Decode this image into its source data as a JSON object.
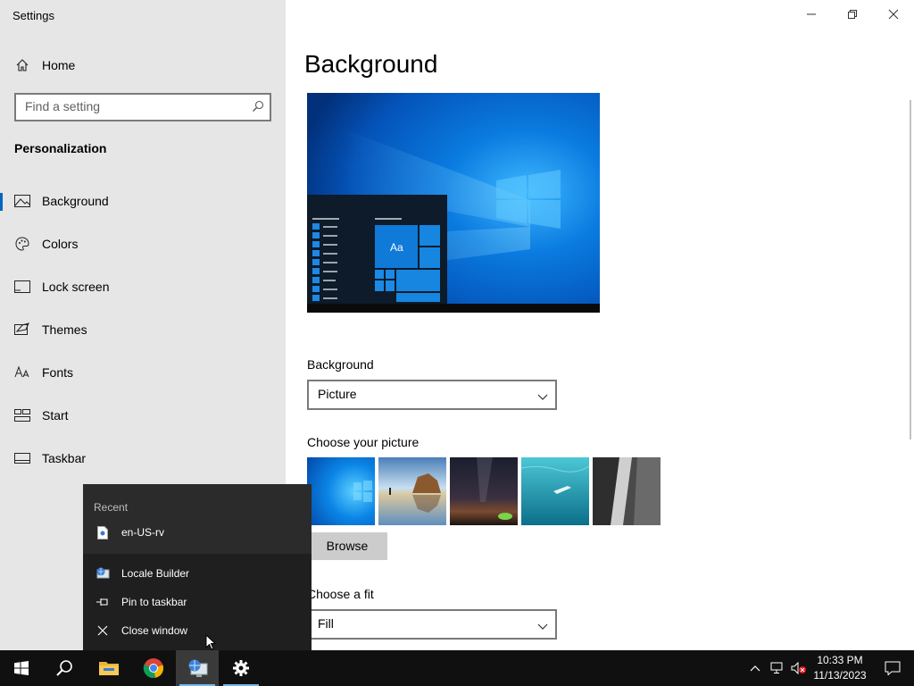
{
  "window": {
    "title": "Settings",
    "controls": {
      "minimize": "minimize",
      "maximize": "restore",
      "close": "close"
    }
  },
  "sidebar": {
    "home_label": "Home",
    "search_placeholder": "Find a setting",
    "section_title": "Personalization",
    "items": [
      {
        "label": "Background",
        "icon": "picture-icon",
        "active": true
      },
      {
        "label": "Colors",
        "icon": "palette-icon",
        "active": false
      },
      {
        "label": "Lock screen",
        "icon": "lock-screen-icon",
        "active": false
      },
      {
        "label": "Themes",
        "icon": "themes-icon",
        "active": false
      },
      {
        "label": "Fonts",
        "icon": "font-icon",
        "active": false
      },
      {
        "label": "Start",
        "icon": "start-layout-icon",
        "active": false
      },
      {
        "label": "Taskbar",
        "icon": "taskbar-icon",
        "active": false
      }
    ]
  },
  "main": {
    "title": "Background",
    "preview_tile_text": "Aa",
    "background_label": "Background",
    "background_value": "Picture",
    "choose_picture_label": "Choose your picture",
    "thumbnails": [
      "windows-light-wallpaper",
      "beach-rock-wallpaper",
      "night-sky-wallpaper",
      "underwater-swimmer-wallpaper",
      "waterfall-rock-wallpaper"
    ],
    "browse_label": "Browse",
    "choose_fit_label": "Choose a fit",
    "fit_value": "Fill"
  },
  "jumplist": {
    "recent_heading": "Recent",
    "recent_items": [
      "en-US-rv"
    ],
    "app_name": "Locale Builder",
    "pin_label": "Pin to taskbar",
    "close_label": "Close window"
  },
  "taskbar": {
    "apps": [
      "start-icon",
      "search-icon",
      "file-explorer-icon",
      "chrome-icon",
      "locale-builder-icon",
      "settings-icon"
    ],
    "time": "10:33 PM",
    "date": "11/13/2023"
  },
  "colors": {
    "accent": "#0067c0",
    "sidebar_bg": "#e6e6e6",
    "taskbar_bg": "#101010"
  }
}
